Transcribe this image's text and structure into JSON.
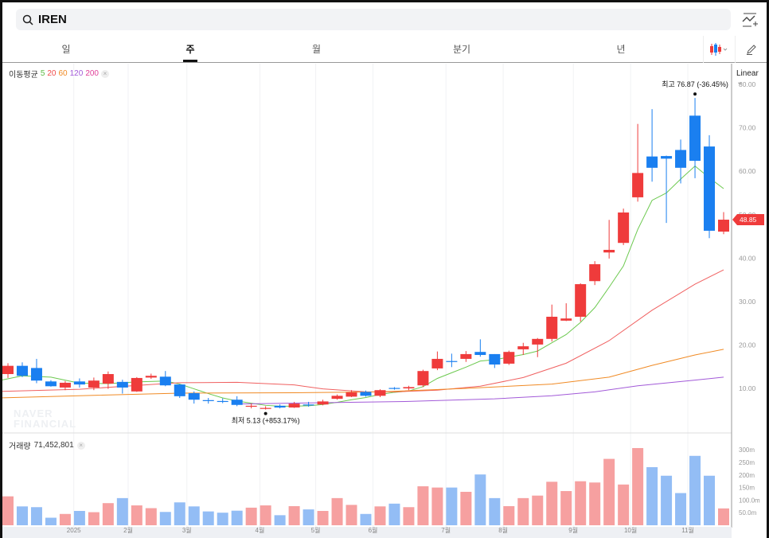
{
  "search": {
    "query": "IREN",
    "icon": "search-icon"
  },
  "tabs": [
    {
      "label": "일",
      "active": false
    },
    {
      "label": "주",
      "active": true
    },
    {
      "label": "월",
      "active": false
    },
    {
      "label": "분기",
      "active": false
    },
    {
      "label": "년",
      "active": false
    }
  ],
  "toolbar": {
    "chart_type_icon": "candlestick-icon",
    "draw_icon": "pencil-icon",
    "add_indicator_icon": "chart-add-icon"
  },
  "ma_legend": {
    "label": "이동평균",
    "periods": [
      {
        "p": "5",
        "color": "#5dbb46"
      },
      {
        "p": "20",
        "color": "#f04b4b"
      },
      {
        "p": "60",
        "color": "#f08a24"
      },
      {
        "p": "120",
        "color": "#a25ad8"
      },
      {
        "p": "200",
        "color": "#e0409a"
      }
    ],
    "close": "×"
  },
  "scale": {
    "label": "Linear"
  },
  "watermark": {
    "line1": "NAVER",
    "line2": "FINANCIAL"
  },
  "volume_legend": {
    "label": "거래량",
    "value": "71,452,801",
    "close": "×"
  },
  "chart_data": {
    "type": "candlestick",
    "up_color": "#ef3b3b",
    "down_color": "#1a7ff0",
    "current_price": "48.85",
    "high_label": {
      "text": "최고",
      "value": "76.87 (-36.45%)",
      "index": 48,
      "price": 76.87
    },
    "low_label": {
      "text": "최저",
      "value": "5.13 (+853.17%)",
      "index": 18,
      "price": 5.13
    },
    "price_axis": {
      "min": 0,
      "max": 85,
      "ticks": [
        "10.00",
        "20.00",
        "30.00",
        "40.00",
        "50.00",
        "60.00",
        "70.00",
        "80.00"
      ]
    },
    "volume_axis": {
      "max": 340,
      "ticks": [
        {
          "v": 50,
          "l": "50.0m"
        },
        {
          "v": 100,
          "l": "100.0m"
        },
        {
          "v": 150,
          "l": "150m"
        },
        {
          "v": 200,
          "l": "200m"
        },
        {
          "v": 250,
          "l": "250m"
        },
        {
          "v": 300,
          "l": "300m"
        }
      ]
    },
    "x_ticks": [
      {
        "i": 4.6,
        "l": "2025"
      },
      {
        "i": 8.4,
        "l": "2월"
      },
      {
        "i": 12.5,
        "l": "3월"
      },
      {
        "i": 17.6,
        "l": "4월"
      },
      {
        "i": 21.5,
        "l": "5월"
      },
      {
        "i": 25.5,
        "l": "6월"
      },
      {
        "i": 30.6,
        "l": "7월"
      },
      {
        "i": 34.6,
        "l": "8월"
      },
      {
        "i": 39.5,
        "l": "9월"
      },
      {
        "i": 43.5,
        "l": "10월"
      },
      {
        "i": 47.5,
        "l": "11월"
      }
    ],
    "ohlc": [
      [
        13.3,
        15.8,
        12.4,
        15.2
      ],
      [
        15.2,
        16,
        12.6,
        12.9
      ],
      [
        14.7,
        16.8,
        11.2,
        11.8
      ],
      [
        11.6,
        11.9,
        10.4,
        10.5
      ],
      [
        10.2,
        11.7,
        9.6,
        11.3
      ],
      [
        11.6,
        12.3,
        10.2,
        10.9
      ],
      [
        10.2,
        12.5,
        9.6,
        11.8
      ],
      [
        11.1,
        13.9,
        9.9,
        13.3
      ],
      [
        11.5,
        12,
        8.8,
        10.2
      ],
      [
        9.3,
        12.6,
        9.2,
        12.4
      ],
      [
        12.5,
        13.4,
        12.2,
        12.9
      ],
      [
        12.7,
        14,
        10.5,
        10.7
      ],
      [
        10.9,
        11,
        7.8,
        8.2
      ],
      [
        8.9,
        9.3,
        6.5,
        7.4
      ],
      [
        7.3,
        7.8,
        6.5,
        7.1
      ],
      [
        7.1,
        7.7,
        6.6,
        7.0
      ],
      [
        7.4,
        8.2,
        5.9,
        6.2
      ],
      [
        5.9,
        6.5,
        5.4,
        6.0
      ],
      [
        5.4,
        5.9,
        5.13,
        5.5
      ],
      [
        6.0,
        6.3,
        5.4,
        5.6
      ],
      [
        5.6,
        6.9,
        5.5,
        6.5
      ],
      [
        6.3,
        6.9,
        5.8,
        6.2
      ],
      [
        6.3,
        7.4,
        6.1,
        7.0
      ],
      [
        7.6,
        8.6,
        7.4,
        8.3
      ],
      [
        8.1,
        9.6,
        8.0,
        9.1
      ],
      [
        9.2,
        9.5,
        8.1,
        8.3
      ],
      [
        8.3,
        9.8,
        8.0,
        9.6
      ],
      [
        10.1,
        10.3,
        9.7,
        9.9
      ],
      [
        10.0,
        10.6,
        9.6,
        10.3
      ],
      [
        10.7,
        14.3,
        10.3,
        14.0
      ],
      [
        14.6,
        18.5,
        14.2,
        16.8
      ],
      [
        16.3,
        18.0,
        14.9,
        16.2
      ],
      [
        16.8,
        18.6,
        16.1,
        17.9
      ],
      [
        18.4,
        21.3,
        17.3,
        17.7
      ],
      [
        17.9,
        17.9,
        14.7,
        15.5
      ],
      [
        15.7,
        18.7,
        15.4,
        18.4
      ],
      [
        19.0,
        20.5,
        17.7,
        19.7
      ],
      [
        20.1,
        21.6,
        17.2,
        21.4
      ],
      [
        21.4,
        29.3,
        20.8,
        26.5
      ],
      [
        25.6,
        29.6,
        25.5,
        26.1
      ],
      [
        26.5,
        34.2,
        25.4,
        34.0
      ],
      [
        34.7,
        39.3,
        33.8,
        38.6
      ],
      [
        41.3,
        48.8,
        39.9,
        41.9
      ],
      [
        43.5,
        51.4,
        43.0,
        50.5
      ],
      [
        54.0,
        70.9,
        53.0,
        59.6
      ],
      [
        63.4,
        74.3,
        57.6,
        60.8
      ],
      [
        63.5,
        63.6,
        48.1,
        62.9
      ],
      [
        64.9,
        67.3,
        57.2,
        60.8
      ],
      [
        72.8,
        76.87,
        58.4,
        62.4
      ],
      [
        65.7,
        68.3,
        44.6,
        46.3
      ],
      [
        46.1,
        50.6,
        45.5,
        48.85
      ]
    ],
    "volume_m": [
      115,
      75,
      72,
      30,
      45,
      57,
      52,
      88,
      108,
      79,
      68,
      53,
      91,
      75,
      55,
      50,
      58,
      70,
      79,
      40,
      76,
      63,
      57,
      108,
      81,
      45,
      75,
      86,
      72,
      155,
      150,
      150,
      133,
      202,
      108,
      76,
      108,
      118,
      173,
      136,
      175,
      170,
      264,
      162,
      307,
      231,
      197,
      128,
      276,
      197,
      67
    ],
    "ma": [
      {
        "period": "5",
        "color": "#6cc94f",
        "points": [
          [
            -0.6,
            11.8
          ],
          [
            1,
            12.9
          ],
          [
            3,
            12.6
          ],
          [
            5,
            11.2
          ],
          [
            7,
            11.1
          ],
          [
            9,
            11.5
          ],
          [
            11,
            11.7
          ],
          [
            12,
            11.0
          ],
          [
            13,
            9.9
          ],
          [
            14,
            8.8
          ],
          [
            15,
            7.8
          ],
          [
            16,
            7.1
          ],
          [
            17,
            6.6
          ],
          [
            18,
            6.1
          ],
          [
            19,
            5.9
          ],
          [
            20,
            5.9
          ],
          [
            21,
            6.0
          ],
          [
            22,
            6.3
          ],
          [
            23,
            6.8
          ],
          [
            24,
            7.4
          ],
          [
            25,
            7.9
          ],
          [
            26,
            8.6
          ],
          [
            27,
            9.1
          ],
          [
            28,
            9.4
          ],
          [
            29,
            10.4
          ],
          [
            30,
            12.3
          ],
          [
            31,
            13.6
          ],
          [
            32,
            14.9
          ],
          [
            33,
            16.3
          ],
          [
            34,
            16.6
          ],
          [
            35,
            17.2
          ],
          [
            36,
            17.8
          ],
          [
            37,
            18.6
          ],
          [
            38,
            20.5
          ],
          [
            39,
            22.4
          ],
          [
            40,
            25.2
          ],
          [
            41,
            28.6
          ],
          [
            42,
            33.3
          ],
          [
            43,
            38.2
          ],
          [
            44,
            46.6
          ],
          [
            45,
            53.3
          ],
          [
            46,
            55.0
          ],
          [
            47,
            58.2
          ],
          [
            48,
            61.2
          ],
          [
            49,
            58.5
          ],
          [
            50,
            56.0
          ]
        ]
      },
      {
        "period": "20",
        "color": "#f06060",
        "points": [
          [
            -0.6,
            9.3
          ],
          [
            5,
            9.8
          ],
          [
            10,
            10.9
          ],
          [
            12,
            11.3
          ],
          [
            16,
            11.4
          ],
          [
            20,
            10.8
          ],
          [
            22,
            9.9
          ],
          [
            25,
            9.2
          ],
          [
            27,
            9.2
          ],
          [
            30,
            9.6
          ],
          [
            33,
            10.5
          ],
          [
            36,
            12.5
          ],
          [
            39,
            15.8
          ],
          [
            42,
            21.0
          ],
          [
            45,
            28.0
          ],
          [
            48,
            34.0
          ],
          [
            50,
            37.3
          ]
        ]
      },
      {
        "period": "60",
        "color": "#f08a24",
        "points": [
          [
            -0.6,
            7.8
          ],
          [
            6,
            8.4
          ],
          [
            12,
            8.9
          ],
          [
            20,
            9.0
          ],
          [
            26,
            9.2
          ],
          [
            32,
            10.0
          ],
          [
            38,
            11.0
          ],
          [
            42,
            12.6
          ],
          [
            45,
            15.3
          ],
          [
            48,
            17.7
          ],
          [
            50,
            19.0
          ]
        ]
      },
      {
        "period": "120",
        "color": "#a25ad8",
        "points": [
          [
            16,
            6.4
          ],
          [
            22,
            6.7
          ],
          [
            28,
            7.0
          ],
          [
            34,
            7.6
          ],
          [
            38,
            8.3
          ],
          [
            41,
            9.2
          ],
          [
            44,
            10.6
          ],
          [
            48,
            11.9
          ],
          [
            50,
            12.6
          ]
        ]
      }
    ]
  }
}
